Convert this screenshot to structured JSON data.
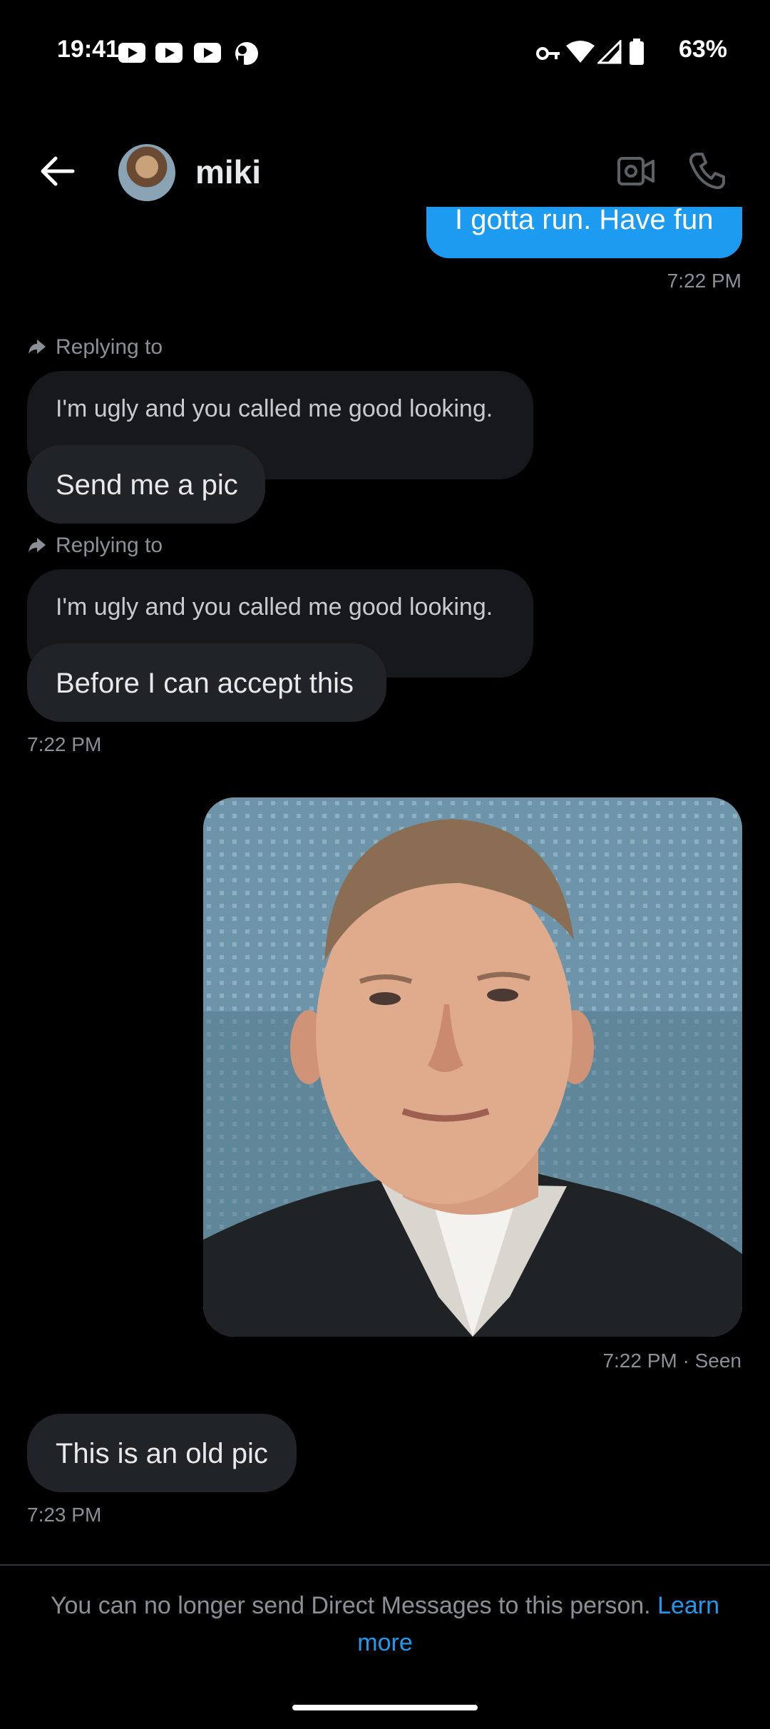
{
  "status_bar": {
    "time": "19:41",
    "battery": "63%"
  },
  "header": {
    "contact_name": "miki"
  },
  "messages": {
    "top_outgoing_text": "I gotta run. Have fun",
    "top_outgoing_time": "7:22 PM",
    "reply1": {
      "label": "Replying to",
      "quote": "I'm ugly and you called me good looking.",
      "text": "Send me a pic"
    },
    "reply2": {
      "label": "Replying to",
      "quote": "I'm ugly and you called me good looking.",
      "text": "Before I can accept this"
    },
    "incoming_time_1": "7:22 PM",
    "photo_time": "7:22 PM · Seen",
    "last_incoming_text": "This is an old pic",
    "last_incoming_time": "7:23 PM"
  },
  "footer": {
    "notice": "You can no longer send Direct Messages to this person.",
    "link": "Learn more"
  },
  "colors": {
    "accent": "#1d9bf0",
    "background": "#000000",
    "incoming_bubble": "#202327"
  }
}
